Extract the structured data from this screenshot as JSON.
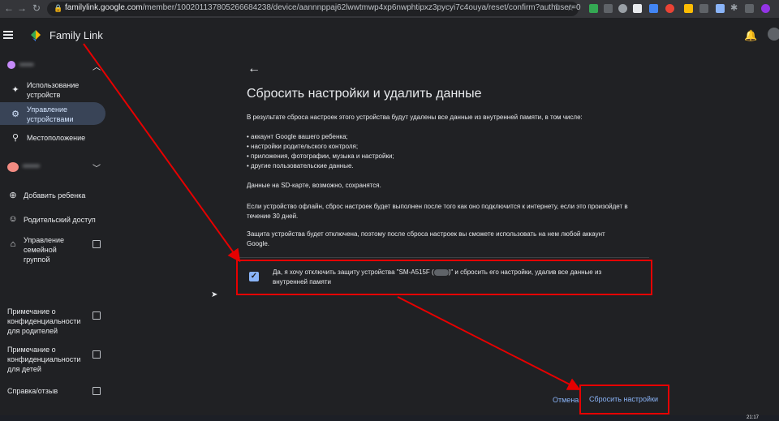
{
  "browser": {
    "url_host": "familylink.google.com",
    "url_path": "/member/100201137805266684238/device/aannnppaj62lwwtmwp4xp6nwphtipxz3pycyi7c4ouya/reset/confirm?authuser=0"
  },
  "app": {
    "title": "Family Link"
  },
  "sidebar": {
    "child1_name": "•••••",
    "child1_items": [
      {
        "icon": "sparkle-icon",
        "label": "Использование устройств"
      },
      {
        "icon": "devices-icon",
        "label": "Управление устройствами"
      },
      {
        "icon": "location-pin-icon",
        "label": "Местоположение"
      }
    ],
    "child2_name": "••••••",
    "items": [
      {
        "icon": "add-person-icon",
        "label": "Добавить ребенка"
      },
      {
        "icon": "person-icon",
        "label": "Родительский доступ"
      },
      {
        "icon": "home-icon",
        "label": "Управление семейной группой"
      }
    ],
    "links": [
      {
        "label": "Примечание о конфиденциальности для родителей"
      },
      {
        "label": "Примечание о конфиденциальности для детей"
      },
      {
        "label": "Справка/отзыв"
      }
    ]
  },
  "main": {
    "title": "Сбросить настройки и удалить данные",
    "intro": "В результате сброса настроек этого устройства будут удалены все данные из внутренней памяти, в том числе:",
    "bullets": [
      "• аккаунт Google вашего ребенка;",
      "• настройки родительского контроля;",
      "• приложения, фотографии, музыка и настройки;",
      "• другие пользовательские данные."
    ],
    "sd_note": "Данные на SD-карте, возможно, сохранятся.",
    "offline_note": "Если устройство офлайн, сброс настроек будет выполнен после того как оно подключится к интернету, если это произойдет в течение 30 дней.",
    "protection_note": "Защита устройства будет отключена, поэтому после сброса настроек вы сможете использовать на нем любой аккаунт Google.",
    "checkbox_label_a": "Да, я хочу отключить защиту устройства \"SM-A515F (",
    "checkbox_label_b": ")\" и сбросить его настройки, удалив все данные из внутренней памяти",
    "checkbox_checked": true,
    "cancel_label": "Отмена",
    "reset_label": "Сбросить настройки"
  },
  "taskbar": {
    "time": "21:17"
  },
  "colors": {
    "background": "#202124",
    "accent": "#8ab4f8",
    "annotation": "#e60000",
    "active_nav": "#394457"
  }
}
